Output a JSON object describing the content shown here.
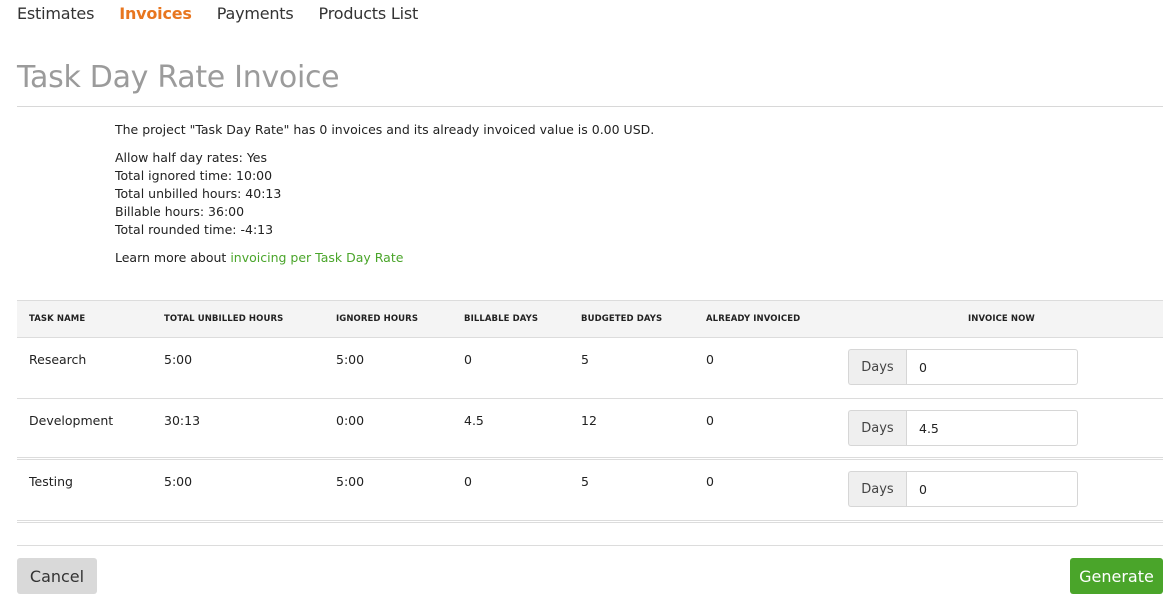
{
  "nav": {
    "items": [
      {
        "label": "Estimates",
        "active": false
      },
      {
        "label": "Invoices",
        "active": true
      },
      {
        "label": "Payments",
        "active": false
      },
      {
        "label": "Products List",
        "active": false
      }
    ]
  },
  "page": {
    "title": "Task Day Rate Invoice"
  },
  "info": {
    "summary": "The project \"Task Day Rate\" has 0 invoices and its already invoiced value is 0.00 USD.",
    "stats": [
      "Allow half day rates: Yes",
      "Total ignored time: 10:00",
      "Total unbilled hours: 40:13",
      "Billable hours: 36:00",
      "Total rounded time: -4:13"
    ],
    "learn_prefix": "Learn more about ",
    "learn_link": "invoicing per Task Day Rate"
  },
  "table": {
    "headers": [
      "TASK NAME",
      "TOTAL UNBILLED HOURS",
      "IGNORED HOURS",
      "BILLABLE DAYS",
      "BUDGETED DAYS",
      "ALREADY INVOICED",
      "INVOICE NOW"
    ],
    "rows": [
      {
        "task": "Research",
        "unbilled": "5:00",
        "ignored": "5:00",
        "billable": "0",
        "budgeted": "5",
        "invoiced": "0",
        "addon": "Days",
        "invoice_now": "0"
      },
      {
        "task": "Development",
        "unbilled": "30:13",
        "ignored": "0:00",
        "billable": "4.5",
        "budgeted": "12",
        "invoiced": "0",
        "addon": "Days",
        "invoice_now": "4.5"
      },
      {
        "task": "Testing",
        "unbilled": "5:00",
        "ignored": "5:00",
        "billable": "0",
        "budgeted": "5",
        "invoiced": "0",
        "addon": "Days",
        "invoice_now": "0"
      }
    ]
  },
  "actions": {
    "cancel_label": "Cancel",
    "generate_label": "Generate"
  },
  "colors": {
    "accent_orange": "#e8761f",
    "primary_green": "#4aa52a",
    "title_gray": "#9b9b9b"
  }
}
